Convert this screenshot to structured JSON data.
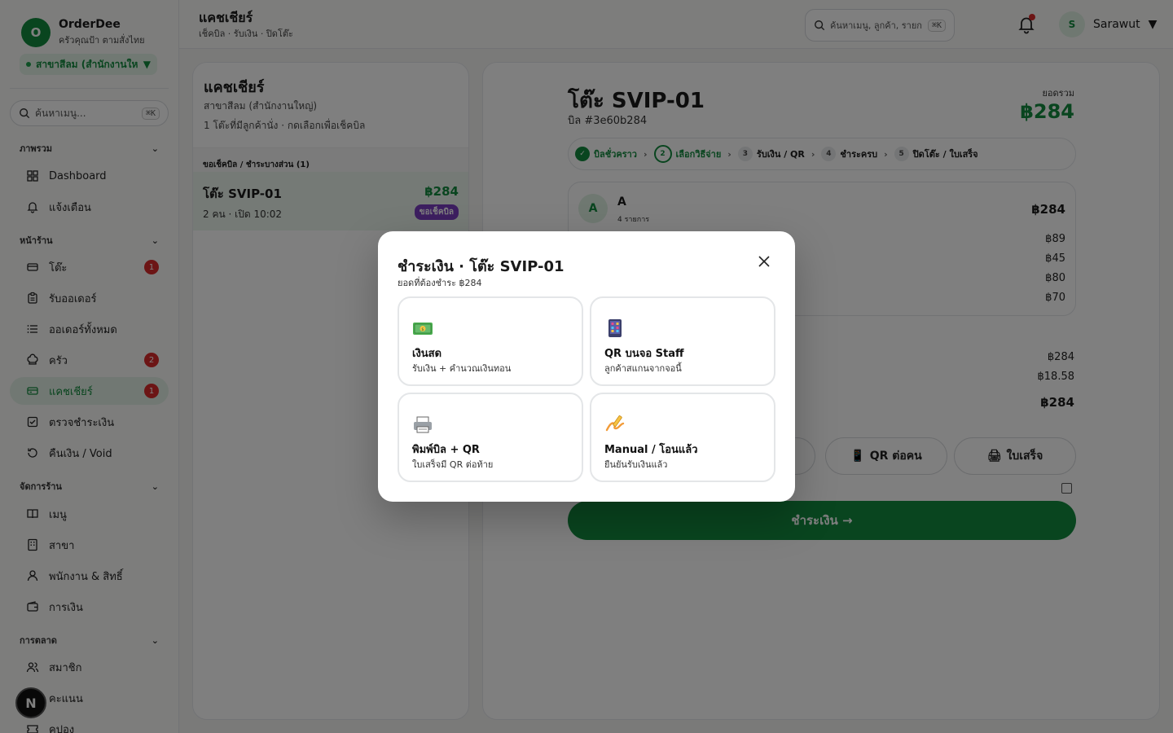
{
  "brand": {
    "logo_letter": "O",
    "name": "OrderDee",
    "tagline": "ครัวคุณป้า ตามสั่งไทย",
    "branch": "สาขาสีลม (สำนักงานให..."
  },
  "sidebar": {
    "search_placeholder": "ค้นหาเมนู...",
    "search_shortcut": "⌘K",
    "groups": {
      "overview": "ภาพรวม",
      "front": "หน้าร้าน",
      "manage": "จัดการร้าน",
      "marketing": "การตลาด"
    },
    "items": {
      "dashboard": "Dashboard",
      "alerts": "แจ้งเตือน",
      "tables": "โต๊ะ",
      "tables_badge": "1",
      "orders": "รับออเดอร์",
      "all_orders": "ออเดอร์ทั้งหมด",
      "kitchen": "ครัว",
      "kitchen_badge": "2",
      "cashier": "แคชเชียร์",
      "cashier_badge": "1",
      "verify": "ตรวจชำระเงิน",
      "refund": "คืนเงิน / Void",
      "menu": "เมนู",
      "branch": "สาขา",
      "staff": "พนักงาน & สิทธิ์",
      "finance": "การเงิน",
      "members": "สมาชิก",
      "points": "คะแนน",
      "coupons": "คูปอง"
    },
    "nextjs_badge": "N"
  },
  "header": {
    "title": "แคชเชียร์",
    "subtitle": "เช็คบิล · รับเงิน · ปิดโต๊ะ",
    "search_placeholder": "ค้นหาเมนู, ลูกค้า, รายการ...",
    "search_shortcut": "⌘K",
    "user_initial": "S",
    "user_name": "Sarawut"
  },
  "left_panel": {
    "title": "แคชเชียร์",
    "branch": "สาขาสีลม (สำนักงานใหญ่)",
    "hint": "1 โต๊ะที่มีลูกค้านั่ง · กดเลือกเพื่อเช็คบิล",
    "section": "ขอเช็คบิล / ชำระบางส่วน (1)",
    "table": {
      "name": "โต๊ะ SVIP-01",
      "price": "฿284",
      "meta": "2 คน · เปิด 10:02",
      "badge": "ขอเช็คบิล"
    }
  },
  "bill": {
    "table": "โต๊ะ SVIP-01",
    "bill_no": "บิล #3e60b284",
    "total_label": "ยอดรวม",
    "total": "฿284",
    "steps": [
      {
        "num": "✓",
        "label": "บิลชั่วคราว",
        "state": "done"
      },
      {
        "num": "2",
        "label": "เลือกวิธีจ่าย",
        "state": "current"
      },
      {
        "num": "3",
        "label": "รับเงิน / QR",
        "state": "todo"
      },
      {
        "num": "4",
        "label": "ชำระครบ",
        "state": "todo"
      },
      {
        "num": "5",
        "label": "ปิดโต๊ะ / ใบเสร็จ",
        "state": "todo"
      }
    ],
    "customer": {
      "initial": "A",
      "name": "A",
      "count": "4 รายการ",
      "total": "฿284"
    },
    "items": [
      "฿89",
      "฿45",
      "฿80",
      "฿70"
    ],
    "summary": [
      "฿284",
      "฿18.58"
    ],
    "grand": "฿284",
    "btn_qr_each": "QR ต่อคน",
    "btn_receipt": "ใบเสร็จ",
    "pay_label": "ชำระเงิน →"
  },
  "modal": {
    "title": "ชำระเงิน · โต๊ะ SVIP-01",
    "subtitle": "ยอดที่ต้องชำระ ฿284",
    "options": [
      {
        "icon": "cash-icon",
        "name": "เงินสด",
        "desc": "รับเงิน + คำนวณเงินทอน"
      },
      {
        "icon": "staff-screen-qr-icon",
        "name": "QR บนจอ Staff",
        "desc": "ลูกค้าสแกนจากจอนี้"
      },
      {
        "icon": "printer-icon",
        "name": "พิมพ์บิล + QR",
        "desc": "ใบเสร็จมี QR ต่อท้าย"
      },
      {
        "icon": "signature-icon",
        "name": "Manual / โอนแล้ว",
        "desc": "ยืนยันรับเงินแล้ว"
      }
    ]
  },
  "colors": {
    "brand_green": "#138a3e",
    "accent_red": "#d92b2b",
    "badge_purple": "#7b3fc0"
  }
}
